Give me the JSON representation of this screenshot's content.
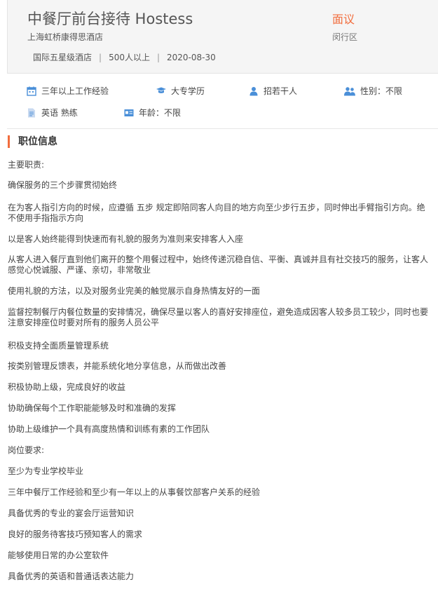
{
  "job": {
    "title": "中餐厅前台接待 Hostess",
    "company": "上海虹桥康得思酒店",
    "company_type": "国际五星级酒店",
    "company_size": "500人以上",
    "date": "2020-08-30",
    "salary": "面议",
    "district": "闵行区"
  },
  "requirements": [
    {
      "icon": "calendar-icon",
      "text": "三年以上工作经验"
    },
    {
      "icon": "graduation-cap-icon",
      "text": "大专学历"
    },
    {
      "icon": "person-icon",
      "text": "招若干人"
    },
    {
      "icon": "gender-icon",
      "text": "性别：不限"
    },
    {
      "icon": "document-icon",
      "text": "英语 熟练"
    },
    {
      "icon": "id-card-icon",
      "text": "年龄：不限"
    }
  ],
  "section": {
    "title": "职位信息"
  },
  "description": [
    "主要职责:",
    "确保服务的三个步骤贯彻始终",
    "在为客人指引方向的时候，应遵循 五步 规定即陪同客人向目的地方向至少步行五步，同时伸出手臂指引方向。绝不使用手指指示方向",
    "以是客人始终能得到快速而有礼貌的服务为准则来安排客人入座",
    "从客人进入餐厅直到他们离开的整个用餐过程中，始终传递沉稳自信、平衡、真诚并且有社交技巧的服务，让客人感觉心悦诚服、严谨、亲切，非常敬业",
    "使用礼貌的方法，以及对服务业完美的触觉展示自身热情友好的一面",
    "监督控制餐厅内餐位数量的安排情况，确保尽量以客人的喜好安排座位，避免造成因客人较多员工较少，同时也要注意安排座位时要对所有的服务人员公平",
    "积极支持全面质量管理系统",
    "按类别管理反馈表，并能系统化地分享信息，从而做出改善",
    "积极协助上级，完成良好的收益",
    "协助确保每个工作职能能够及时和准确的发挥",
    "协助上级维护一个具有高度热情和训练有素的工作团队",
    "岗位要求:",
    "至少为专业学校毕业",
    "三年中餐厅工作经验和至少有一年以上的从事餐饮部客户关系的经验",
    "具备优秀的专业的宴会厅运营知识",
    "良好的服务待客技巧预知客人的需求",
    "能够使用日常的办公室软件",
    "具备优秀的英语和普通话表达能力"
  ]
}
